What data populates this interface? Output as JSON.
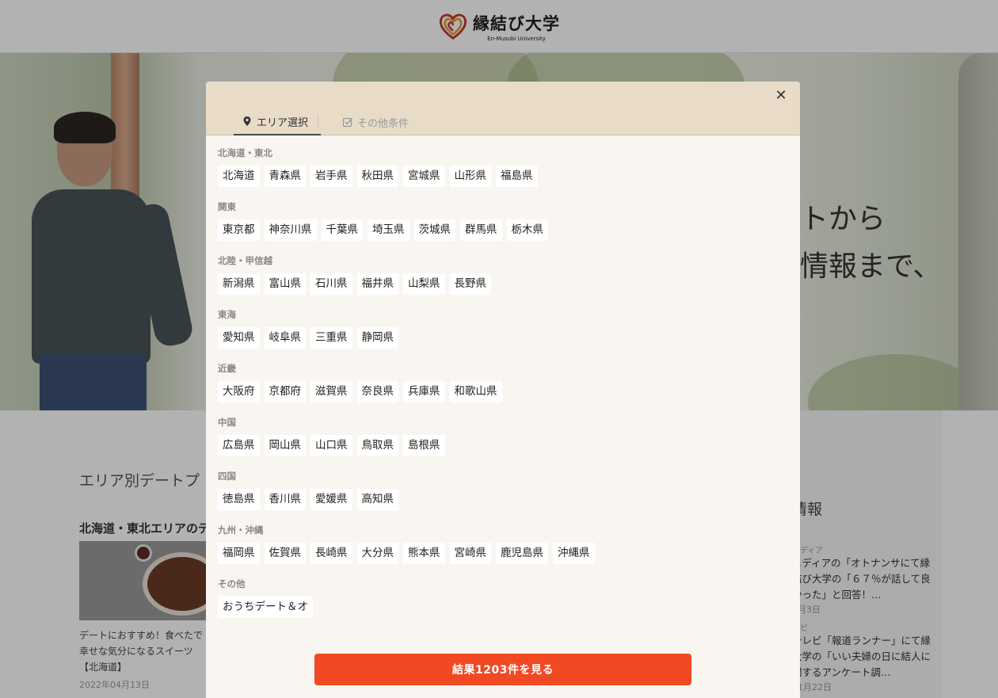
{
  "site": {
    "logo_title": "縁結び大学",
    "logo_subtitle": "En-Musubi University"
  },
  "hero": {
    "line1": "トから",
    "line2": "情報まで、"
  },
  "background": {
    "section_title": "エリア別デートプ",
    "region_title": "北海道・東北エリアのデ",
    "article_text": "デートにおすすめ！食べたで幸せな気分になるスイーツ【北海道】",
    "article_date": "2022年04月13日",
    "side_title": "情報",
    "news": [
      {
        "category": "メディア",
        "text": "メディアの「オトナンサにて縁結び大学の「６７％が話して良かった」と回答！…",
        "date": "4月3日"
      },
      {
        "category": "レビ",
        "text": "テレビ「報道ランナー」にて縁大学の「いい夫婦の日に結人に関するアンケート調…",
        "date": "11月22日"
      }
    ]
  },
  "modal": {
    "tabs": {
      "area": "エリア選択",
      "other": "その他条件"
    },
    "groups": [
      {
        "label": "北海道・東北",
        "prefs": [
          "北海道",
          "青森県",
          "岩手県",
          "秋田県",
          "宮城県",
          "山形県",
          "福島県"
        ]
      },
      {
        "label": "関東",
        "prefs": [
          "東京都",
          "神奈川県",
          "千葉県",
          "埼玉県",
          "茨城県",
          "群馬県",
          "栃木県"
        ]
      },
      {
        "label": "北陸・甲信越",
        "prefs": [
          "新潟県",
          "富山県",
          "石川県",
          "福井県",
          "山梨県",
          "長野県"
        ]
      },
      {
        "label": "東海",
        "prefs": [
          "愛知県",
          "岐阜県",
          "三重県",
          "静岡県"
        ]
      },
      {
        "label": "近畿",
        "prefs": [
          "大阪府",
          "京都府",
          "滋賀県",
          "奈良県",
          "兵庫県",
          "和歌山県"
        ]
      },
      {
        "label": "中国",
        "prefs": [
          "広島県",
          "岡山県",
          "山口県",
          "鳥取県",
          "島根県"
        ]
      },
      {
        "label": "四国",
        "prefs": [
          "徳島県",
          "香川県",
          "愛媛県",
          "高知県"
        ]
      },
      {
        "label": "九州・沖縄",
        "prefs": [
          "福岡県",
          "佐賀県",
          "長崎県",
          "大分県",
          "熊本県",
          "宮崎県",
          "鹿児島県",
          "沖縄県"
        ]
      },
      {
        "label": "その他",
        "prefs": [
          "おうちデート＆オ"
        ]
      }
    ],
    "result_button": "結果1203件を見る"
  },
  "colors": {
    "accent": "#f04923",
    "modal_header": "#e8dcc9",
    "modal_body": "#f9f6f1"
  }
}
